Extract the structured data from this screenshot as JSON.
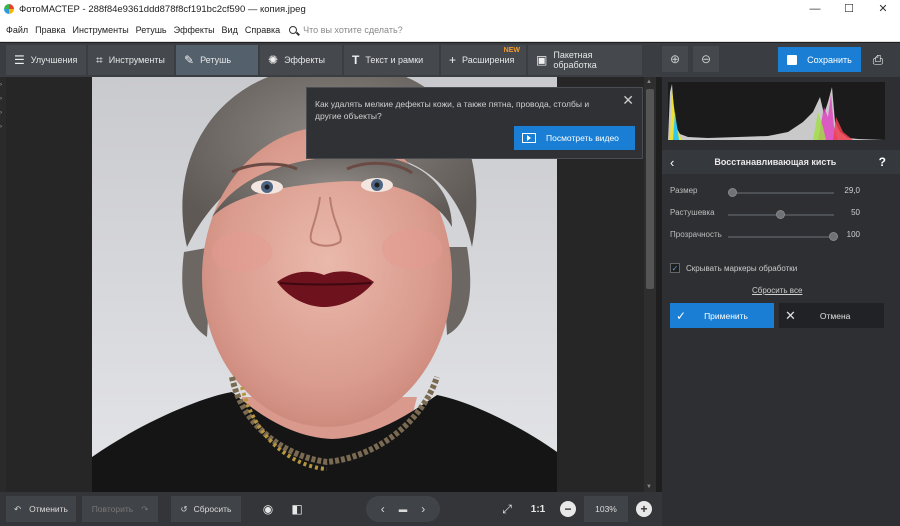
{
  "titlebar": {
    "title": "ФотоМАСТЕР - 288f84e9361ddd878f8cf191bc2cf590 — копия.jpeg",
    "minimize": "—",
    "maximize": "☐",
    "close": "✕"
  },
  "menu": {
    "items": [
      "Файл",
      "Правка",
      "Инструменты",
      "Ретушь",
      "Эффекты",
      "Вид",
      "Справка"
    ],
    "search_placeholder": "Что вы хотите сделать?"
  },
  "toolbar": {
    "tabs": [
      {
        "label": "Улучшения",
        "icon": "sliders-icon"
      },
      {
        "label": "Инструменты",
        "icon": "crop-icon"
      },
      {
        "label": "Ретушь",
        "icon": "brush-icon"
      },
      {
        "label": "Эффекты",
        "icon": "sparkle-icon"
      },
      {
        "label": "Текст и рамки",
        "icon": "text-icon"
      },
      {
        "label": "Расширения",
        "icon": "plus-icon",
        "badge": "NEW"
      },
      {
        "label": "Пакетная обработка",
        "icon": "batch-icon"
      }
    ],
    "active_tab": "Ретушь",
    "save_label": "Сохранить"
  },
  "tooltip": {
    "message": "Как удалять мелкие дефекты кожи, а также пятна, провода, столбы и другие объекты?",
    "video_button": "Посмотреть видео"
  },
  "panel": {
    "title": "Восстанавливающая кисть",
    "help": "?",
    "sliders": [
      {
        "label": "Размер",
        "value": "29,0",
        "fraction": 0.05
      },
      {
        "label": "Растушевка",
        "value": "50",
        "fraction": 0.5
      },
      {
        "label": "Прозрачность",
        "value": "100",
        "fraction": 1.0
      }
    ],
    "hide_markers_label": "Скрывать маркеры обработки",
    "hide_markers_checked": true,
    "reset_all": "Сбросить все",
    "apply": "Применить",
    "cancel": "Отмена"
  },
  "bottom": {
    "undo": "Отменить",
    "redo": "Повторить",
    "reset": "Сбросить",
    "ratio": "1:1",
    "zoom": "103%"
  },
  "colors": {
    "accent": "#1a7fd4",
    "toolbar_bg": "#3a3d41",
    "panel_bg": "#2d2f32"
  }
}
